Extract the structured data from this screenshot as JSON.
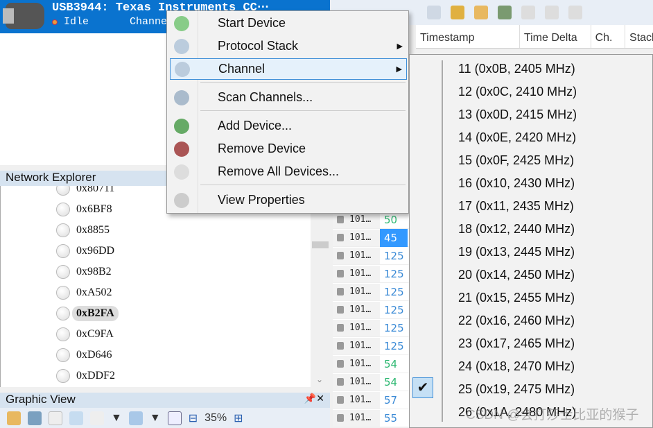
{
  "device": {
    "title": "USB3944: Texas Instruments CC⋯",
    "status": "Idle",
    "channel_label": "Channel"
  },
  "network_explorer": {
    "title": "Network Explorer",
    "nodes": [
      "0x80711",
      "0x6BF8",
      "0x8855",
      "0x96DD",
      "0x98B2",
      "0xA502",
      "0xB2FA",
      "0xC9FA",
      "0xD646",
      "0xDDF2"
    ],
    "selected": "0xB2FA"
  },
  "graphic_view": {
    "title": "Graphic View",
    "zoom": "35%"
  },
  "packet_table": {
    "columns": [
      "Timestamp",
      "Time Delta",
      "Ch.",
      "Stack"
    ],
    "rows": [
      {
        "c1": "101…",
        "c2": "50",
        "color": "#2eb872"
      },
      {
        "c1": "101…",
        "c2": "45",
        "color": "#ffffff",
        "selected": true
      },
      {
        "c1": "101…",
        "c2": "125",
        "color": "#3a8ad6"
      },
      {
        "c1": "101…",
        "c2": "125",
        "color": "#3a8ad6"
      },
      {
        "c1": "101…",
        "c2": "125",
        "color": "#3a8ad6"
      },
      {
        "c1": "101…",
        "c2": "125",
        "color": "#3a8ad6"
      },
      {
        "c1": "101…",
        "c2": "125",
        "color": "#3a8ad6"
      },
      {
        "c1": "101…",
        "c2": "125",
        "color": "#3a8ad6"
      },
      {
        "c1": "101…",
        "c2": "54",
        "color": "#2eb872"
      },
      {
        "c1": "101…",
        "c2": "54",
        "color": "#2eb872"
      },
      {
        "c1": "101…",
        "c2": "57",
        "color": "#3a8ad6"
      },
      {
        "c1": "101…",
        "c2": "55",
        "color": "#3a8ad6"
      }
    ]
  },
  "context_menu": {
    "items": [
      {
        "label": "Start Device",
        "icon": "play-icon"
      },
      {
        "label": "Protocol Stack",
        "icon": "stack-icon",
        "submenu": true
      },
      {
        "label": "Channel",
        "icon": "channel-icon",
        "submenu": true,
        "highlighted": true
      },
      {
        "label": "Scan Channels...",
        "icon": "scan-icon"
      },
      {
        "label": "Add Device...",
        "icon": "add-device-icon"
      },
      {
        "label": "Remove Device",
        "icon": "remove-device-icon"
      },
      {
        "label": "Remove All Devices...",
        "icon": "remove-all-icon"
      },
      {
        "label": "View Properties",
        "icon": "properties-icon"
      }
    ]
  },
  "channel_submenu": {
    "items": [
      "11 (0x0B, 2405 MHz)",
      "12 (0x0C, 2410 MHz)",
      "13 (0x0D, 2415 MHz)",
      "14 (0x0E, 2420 MHz)",
      "15 (0x0F, 2425 MHz)",
      "16 (0x10, 2430 MHz)",
      "17 (0x11, 2435 MHz)",
      "18 (0x12, 2440 MHz)",
      "19 (0x13, 2445 MHz)",
      "20 (0x14, 2450 MHz)",
      "21 (0x15, 2455 MHz)",
      "22 (0x16, 2460 MHz)",
      "23 (0x17, 2465 MHz)",
      "24 (0x18, 2470 MHz)",
      "25 (0x19, 2475 MHz)",
      "26 (0x1A, 2480 MHz)"
    ],
    "checked": "25 (0x19, 2475 MHz)"
  },
  "watermark": "CSDN @会打莎士比亚的猴子"
}
